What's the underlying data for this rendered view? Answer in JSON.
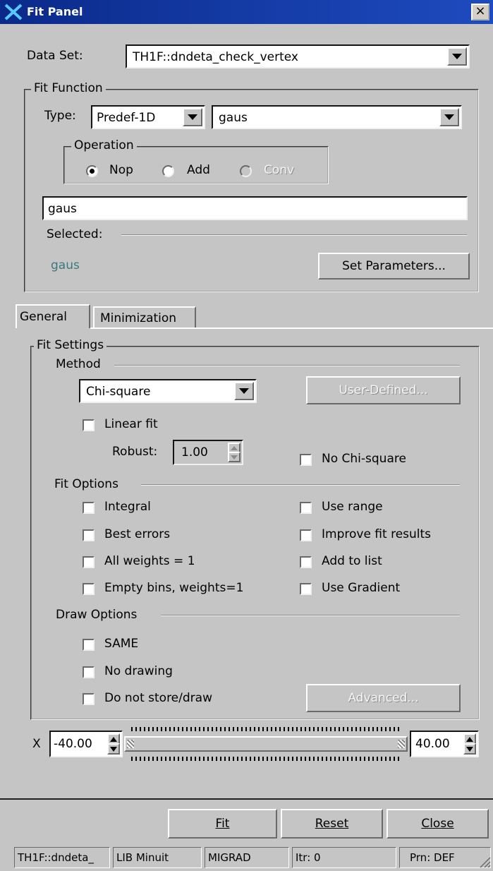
{
  "window": {
    "title": "Fit Panel",
    "close_glyph": "×"
  },
  "dataset": {
    "label": "Data Set:",
    "value": "TH1F::dndeta_check_vertex"
  },
  "fit_function": {
    "group_label": "Fit Function",
    "type_label": "Type:",
    "type_value": "Predef-1D",
    "function_value": "gaus",
    "operation": {
      "label": "Operation",
      "options": [
        {
          "label": "Nop",
          "checked": true,
          "enabled": true
        },
        {
          "label": "Add",
          "checked": false,
          "enabled": true
        },
        {
          "label": "Conv",
          "checked": false,
          "enabled": false
        }
      ]
    },
    "formula_value": "gaus",
    "selected_label": "Selected:",
    "selected_value": "gaus",
    "set_parameters_label": "Set Parameters..."
  },
  "tabs": [
    {
      "label": "General",
      "active": true
    },
    {
      "label": "Minimization",
      "active": false
    }
  ],
  "fit_settings": {
    "group_label": "Fit Settings",
    "method_label": "Method",
    "method_value": "Chi-square",
    "user_defined_label": "User-Defined...",
    "linear_fit_label": "Linear fit",
    "robust_label": "Robust:",
    "robust_value": "1.00",
    "no_chisquare_label": "No Chi-square",
    "fit_options_label": "Fit Options",
    "fit_options_left": [
      "Integral",
      "Best errors",
      "All weights = 1",
      "Empty bins, weights=1"
    ],
    "fit_options_right": [
      "Use range",
      "Improve fit results",
      "Add to list",
      "Use Gradient"
    ],
    "draw_options_label": "Draw Options",
    "draw_options": [
      "SAME",
      "No drawing",
      "Do not store/draw"
    ],
    "advanced_label": "Advanced..."
  },
  "range": {
    "axis_label": "X",
    "min_value": "-40.00",
    "max_value": "40.00"
  },
  "buttons": {
    "fit": "Fit",
    "reset": "Reset",
    "close": "Close"
  },
  "status_bar": [
    "TH1F::dndeta_",
    "LIB Minuit",
    "MIGRAD",
    "Itr: 0",
    "Prn: DEF"
  ],
  "colors": {
    "title_bar": "#0a2a8a",
    "selected_text": "#3a7a7a",
    "background": "#c5c5c5"
  }
}
